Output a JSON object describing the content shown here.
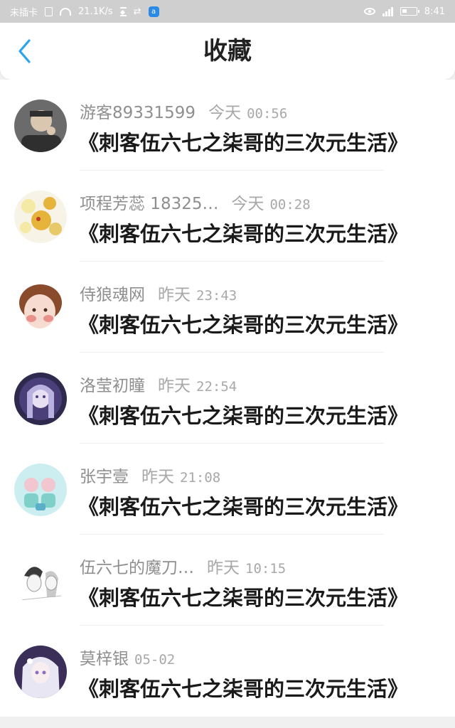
{
  "status_bar": {
    "carrier": "未插卡",
    "speed": "21.1K/s",
    "app_badge": "a",
    "time": "8:41"
  },
  "header": {
    "title": "收藏"
  },
  "items": [
    {
      "name": "游客89331599",
      "day": "今天",
      "time": "00:56",
      "title": "《刺客伍六七之柒哥的三次元生活》",
      "avatar_colors": [
        "#6b6b6b",
        "#d9c7b0",
        "#2f2f2f"
      ]
    },
    {
      "name": "项程芳蕊 18325…",
      "day": "今天",
      "time": "00:28",
      "title": "《刺客伍六七之柒哥的三次元生活》",
      "avatar_colors": [
        "#f5e9a6",
        "#e6b43a",
        "#f7f3e6"
      ]
    },
    {
      "name": "侍狼魂网",
      "day": "昨天",
      "time": "23:43",
      "title": "《刺客伍六七之柒哥的三次元生活》",
      "avatar_colors": [
        "#ffffff",
        "#8a4a2c",
        "#f3c6b8"
      ]
    },
    {
      "name": "洛莹初瞳",
      "day": "昨天",
      "time": "22:54",
      "title": "《刺客伍六七之柒哥的三次元生活》",
      "avatar_colors": [
        "#4b3f7a",
        "#b9b2e0",
        "#2d2a4e"
      ]
    },
    {
      "name": "张宇壹",
      "day": "昨天",
      "time": "21:08",
      "title": "《刺客伍六七之柒哥的三次元生活》",
      "avatar_colors": [
        "#cdeef0",
        "#7fd0c8",
        "#f2c6cf"
      ]
    },
    {
      "name": "伍六七的魔刀…",
      "day": "昨天",
      "time": "10:15",
      "title": "《刺客伍六七之柒哥的三次元生活》",
      "avatar_colors": [
        "#ffffff",
        "#3a3a3a",
        "#c9c9c9"
      ]
    },
    {
      "name": "莫梓银",
      "day": "",
      "time": "05-02",
      "title": "《刺客伍六七之柒哥的三次元生活》",
      "avatar_colors": [
        "#3b2f5a",
        "#e9e6f4",
        "#8b6fc0"
      ]
    }
  ],
  "colors": {
    "accent": "#2aa3f0",
    "title_text": "#1a1a1a",
    "meta_text": "#8f8f8f"
  }
}
